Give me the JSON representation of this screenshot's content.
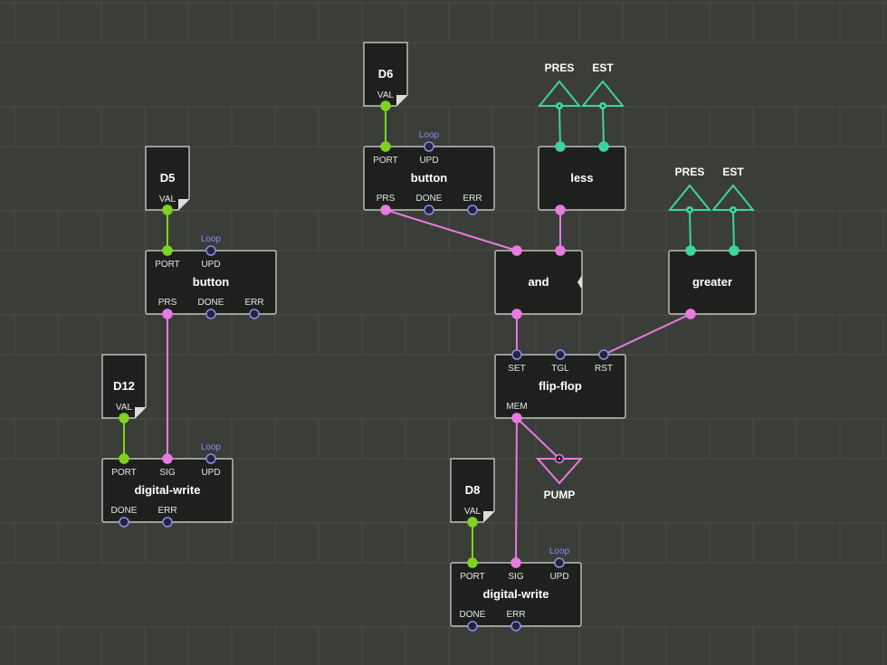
{
  "colors": {
    "background": "#3b3d39",
    "grid": "#4b4d48",
    "node_fill": "#1e201e",
    "node_stroke": "#dcdcdc",
    "pin_number": "#7ed321",
    "pin_boolean": "#e77be0",
    "pin_pulse": "#8e8cf0",
    "pin_pulse_dark": "#23253a",
    "terminal": "#3ad5a0"
  },
  "constants": [
    {
      "id": "c_d6",
      "title": "D6",
      "pin": "VAL"
    },
    {
      "id": "c_d5",
      "title": "D5",
      "pin": "VAL"
    },
    {
      "id": "c_d12",
      "title": "D12",
      "pin": "VAL"
    },
    {
      "id": "c_d8",
      "title": "D8",
      "pin": "VAL"
    }
  ],
  "nodes": [
    {
      "id": "btn1",
      "title": "button",
      "inputs": [
        {
          "label": "PORT",
          "type": "number"
        },
        {
          "label": "UPD",
          "type": "pulse",
          "note": "Loop"
        }
      ],
      "outputs": [
        {
          "label": "PRS",
          "type": "boolean"
        },
        {
          "label": "DONE",
          "type": "pulse"
        },
        {
          "label": "ERR",
          "type": "pulse"
        }
      ]
    },
    {
      "id": "btn2",
      "title": "button",
      "inputs": [
        {
          "label": "PORT",
          "type": "number"
        },
        {
          "label": "UPD",
          "type": "pulse",
          "note": "Loop"
        }
      ],
      "outputs": [
        {
          "label": "PRS",
          "type": "boolean"
        },
        {
          "label": "DONE",
          "type": "pulse"
        },
        {
          "label": "ERR",
          "type": "pulse"
        }
      ]
    },
    {
      "id": "less",
      "title": "less",
      "inputs": [
        {
          "label": "",
          "type": "terminal"
        },
        {
          "label": "",
          "type": "terminal"
        }
      ],
      "outputs": [
        {
          "label": "",
          "type": "boolean"
        }
      ]
    },
    {
      "id": "greater",
      "title": "greater",
      "inputs": [
        {
          "label": "",
          "type": "terminal"
        },
        {
          "label": "",
          "type": "terminal"
        }
      ],
      "outputs": [
        {
          "label": "",
          "type": "boolean"
        }
      ]
    },
    {
      "id": "and",
      "title": "and",
      "inputs": [
        {
          "label": "",
          "type": "boolean"
        },
        {
          "label": "",
          "type": "boolean"
        }
      ],
      "outputs": [
        {
          "label": "",
          "type": "boolean"
        }
      ]
    },
    {
      "id": "ff",
      "title": "flip-flop",
      "inputs": [
        {
          "label": "SET",
          "type": "pulse"
        },
        {
          "label": "TGL",
          "type": "pulse_dark"
        },
        {
          "label": "RST",
          "type": "pulse"
        }
      ],
      "outputs": [
        {
          "label": "MEM",
          "type": "boolean"
        }
      ]
    },
    {
      "id": "dw1",
      "title": "digital-write",
      "inputs": [
        {
          "label": "PORT",
          "type": "number"
        },
        {
          "label": "SIG",
          "type": "boolean"
        },
        {
          "label": "UPD",
          "type": "pulse",
          "note": "Loop"
        }
      ],
      "outputs": [
        {
          "label": "DONE",
          "type": "pulse"
        },
        {
          "label": "ERR",
          "type": "pulse"
        }
      ]
    },
    {
      "id": "dw2",
      "title": "digital-write",
      "inputs": [
        {
          "label": "PORT",
          "type": "number"
        },
        {
          "label": "SIG",
          "type": "boolean"
        },
        {
          "label": "UPD",
          "type": "pulse",
          "note": "Loop"
        }
      ],
      "outputs": [
        {
          "label": "DONE",
          "type": "pulse"
        },
        {
          "label": "ERR",
          "type": "pulse"
        }
      ]
    }
  ],
  "inputs_terminals": [
    {
      "id": "t_pres1",
      "label": "PRES"
    },
    {
      "id": "t_est1",
      "label": "EST"
    },
    {
      "id": "t_pres2",
      "label": "PRES"
    },
    {
      "id": "t_est2",
      "label": "EST"
    }
  ],
  "outputs_terminals": [
    {
      "id": "t_pump",
      "label": "PUMP",
      "type": "boolean"
    }
  ],
  "links": [
    {
      "from": "c_d6.VAL",
      "to": "btn1.PORT",
      "type": "number"
    },
    {
      "from": "c_d5.VAL",
      "to": "btn2.PORT",
      "type": "number"
    },
    {
      "from": "c_d12.VAL",
      "to": "dw1.PORT",
      "type": "number"
    },
    {
      "from": "c_d8.VAL",
      "to": "dw2.PORT",
      "type": "number"
    },
    {
      "from": "t_pres1",
      "to": "less.in0",
      "type": "terminal"
    },
    {
      "from": "t_est1",
      "to": "less.in1",
      "type": "terminal"
    },
    {
      "from": "t_pres2",
      "to": "greater.in0",
      "type": "terminal"
    },
    {
      "from": "t_est2",
      "to": "greater.in1",
      "type": "terminal"
    },
    {
      "from": "btn1.PRS",
      "to": "and.in0",
      "type": "boolean"
    },
    {
      "from": "less.out0",
      "to": "and.in1",
      "type": "boolean"
    },
    {
      "from": "and.out0",
      "to": "ff.SET",
      "type": "boolean"
    },
    {
      "from": "greater.out0",
      "to": "ff.RST",
      "type": "boolean"
    },
    {
      "from": "ff.MEM",
      "to": "t_pump",
      "type": "boolean"
    },
    {
      "from": "ff.MEM",
      "to": "dw2.SIG",
      "type": "boolean"
    },
    {
      "from": "btn2.PRS",
      "to": "dw1.SIG",
      "type": "boolean"
    }
  ]
}
